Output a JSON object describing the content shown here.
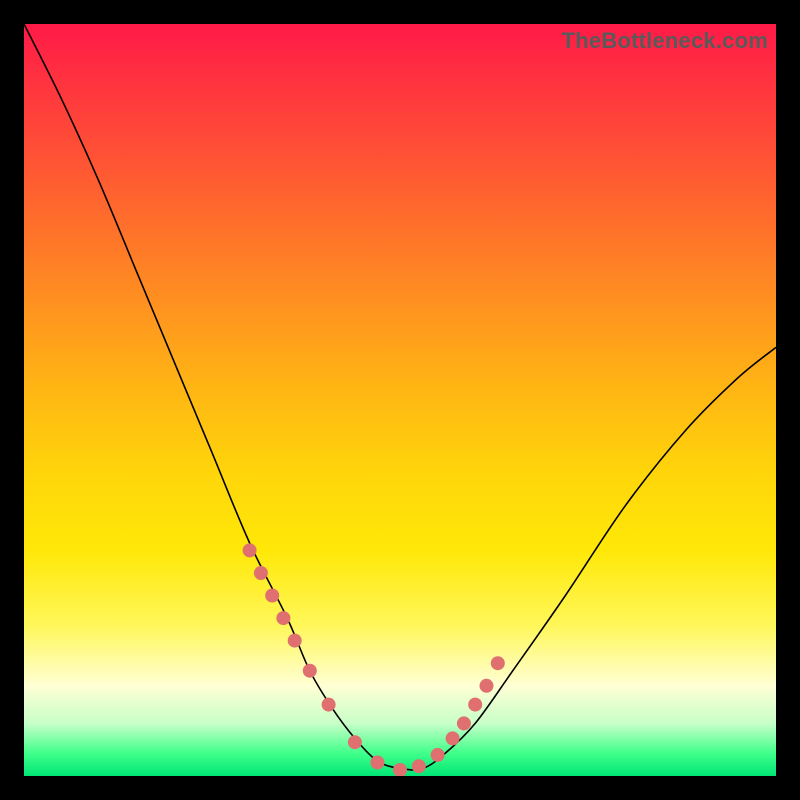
{
  "watermark": "TheBottleneck.com",
  "colors": {
    "gradient_top": "#ff1a47",
    "gradient_mid": "#ffd60a",
    "gradient_bottom": "#00e676",
    "curve": "#000000",
    "markers": "#e07070",
    "frame_border": "#000000"
  },
  "chart_data": {
    "type": "line",
    "title": "",
    "xlabel": "",
    "ylabel": "",
    "xlim": [
      0,
      100
    ],
    "ylim": [
      0,
      100
    ],
    "grid": false,
    "legend": false,
    "series": [
      {
        "name": "bottleneck-curve",
        "x": [
          0,
          5,
          10,
          15,
          20,
          25,
          30,
          35,
          38,
          41,
          44,
          47,
          50,
          53,
          56,
          60,
          65,
          72,
          80,
          88,
          95,
          100
        ],
        "y": [
          100,
          90,
          79,
          67,
          55,
          43,
          31,
          21,
          14,
          9,
          5,
          2,
          1,
          1,
          3,
          7,
          14,
          24,
          36,
          46,
          53,
          57
        ]
      }
    ],
    "markers": {
      "name": "highlighted-points",
      "x": [
        30,
        31.5,
        33,
        34.5,
        36,
        38,
        40.5,
        44,
        47,
        50,
        52.5,
        55,
        57,
        58.5,
        60,
        61.5,
        63
      ],
      "y": [
        30,
        27,
        24,
        21,
        18,
        14,
        9.5,
        4.5,
        1.8,
        0.8,
        1.3,
        2.8,
        5,
        7,
        9.5,
        12,
        15
      ]
    }
  }
}
